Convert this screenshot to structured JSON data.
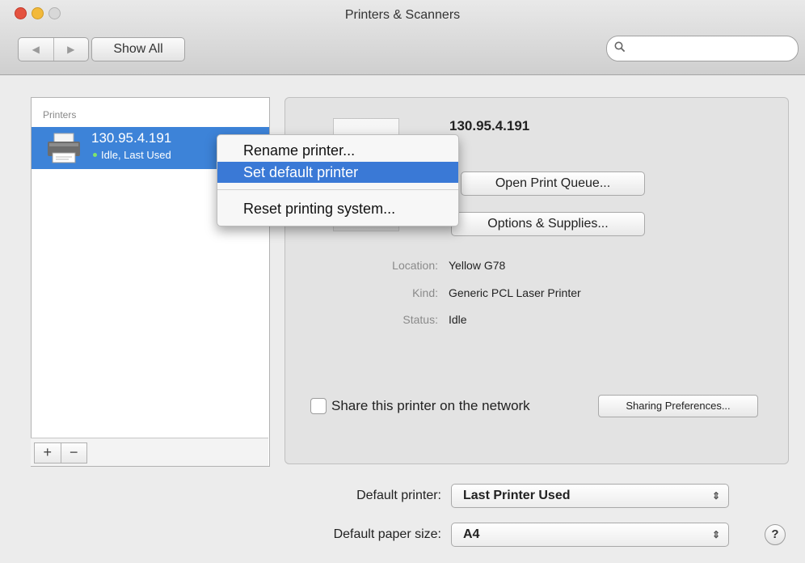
{
  "window": {
    "title": "Printers & Scanners"
  },
  "toolbar": {
    "back_glyph": "◀",
    "forward_glyph": "▶",
    "show_all": "Show All",
    "search_placeholder": "",
    "search_icon": "search-icon"
  },
  "printers": {
    "header": "Printers",
    "items": [
      {
        "name": "130.95.4.191",
        "status": "Idle, Last Used",
        "selected": true
      }
    ],
    "add_label": "+",
    "remove_label": "−"
  },
  "context_menu": {
    "items": [
      {
        "label": "Rename printer...",
        "highlighted": false
      },
      {
        "label": "Set default printer",
        "highlighted": true
      },
      {
        "label": "Reset printing system...",
        "highlighted": false
      }
    ]
  },
  "detail": {
    "name": "130.95.4.191",
    "open_queue": "Open Print Queue...",
    "options_supplies": "Options & Supplies...",
    "location_label": "Location:",
    "location_value": "Yellow G78",
    "kind_label": "Kind:",
    "kind_value": "Generic PCL Laser Printer",
    "status_label": "Status:",
    "status_value": "Idle",
    "share_label": "Share this printer on the network",
    "share_checked": false,
    "sharing_prefs": "Sharing Preferences..."
  },
  "defaults": {
    "default_printer_label": "Default printer:",
    "default_printer_value": "Last Printer Used",
    "paper_size_label": "Default paper size:",
    "paper_size_value": "A4",
    "stepper_glyph": "⇕",
    "help": "?"
  },
  "colors": {
    "selection": "#3d83d8",
    "menu_highlight": "#3a79d6",
    "window_bg": "#ececec"
  }
}
